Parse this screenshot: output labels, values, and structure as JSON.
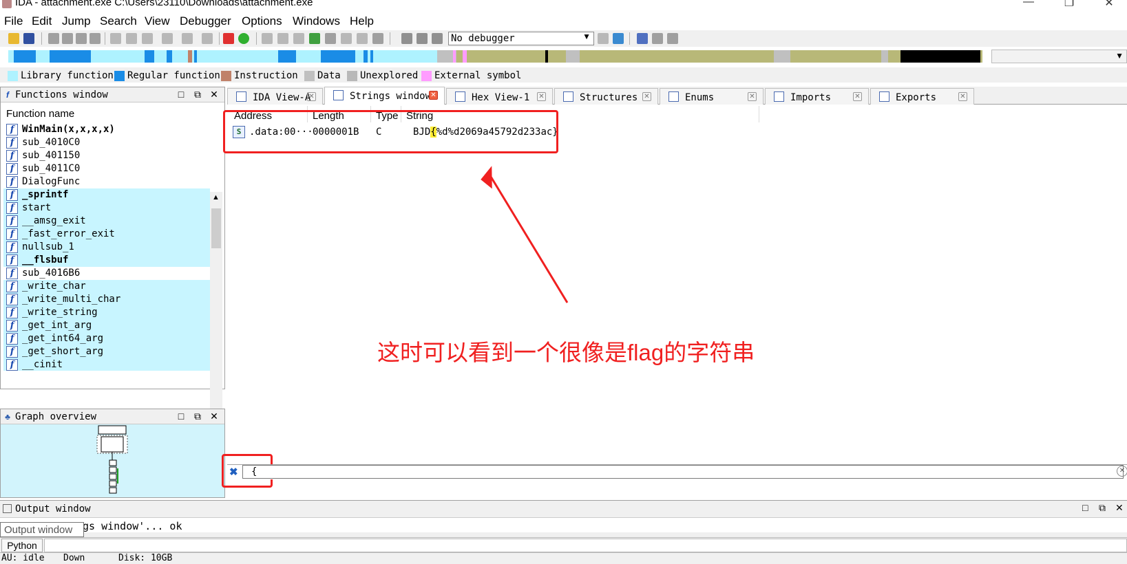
{
  "window": {
    "title": "IDA - attachment.exe C:\\Users\\23110\\Downloads\\attachment.exe"
  },
  "menu": [
    "File",
    "Edit",
    "Jump",
    "Search",
    "View",
    "Debugger",
    "Options",
    "Windows",
    "Help"
  ],
  "toolbar": {
    "debugger_select": "No debugger"
  },
  "legend": [
    {
      "label": "Library function",
      "color": "#aef2ff"
    },
    {
      "label": "Regular function",
      "color": "#1a8ce6"
    },
    {
      "label": "Instruction",
      "color": "#c0826a"
    },
    {
      "label": "Data",
      "color": "#c0c0c0"
    },
    {
      "label": "Unexplored",
      "color": "#b8b878"
    },
    {
      "label": "External symbol",
      "color": "#ff9cff"
    }
  ],
  "functions_window": {
    "title": "Functions window",
    "column": "Function name",
    "items": [
      {
        "name": "WinMain(x,x,x,x)",
        "lib": false,
        "bold": true
      },
      {
        "name": "sub_4010C0",
        "lib": false,
        "bold": false
      },
      {
        "name": "sub_401150",
        "lib": false,
        "bold": false
      },
      {
        "name": "sub_4011C0",
        "lib": false,
        "bold": false
      },
      {
        "name": "DialogFunc",
        "lib": false,
        "bold": false
      },
      {
        "name": "_sprintf",
        "lib": true,
        "bold": true
      },
      {
        "name": "start",
        "lib": true,
        "bold": false
      },
      {
        "name": "__amsg_exit",
        "lib": true,
        "bold": false
      },
      {
        "name": "_fast_error_exit",
        "lib": true,
        "bold": false
      },
      {
        "name": "nullsub_1",
        "lib": true,
        "bold": false
      },
      {
        "name": "__flsbuf",
        "lib": true,
        "bold": true
      },
      {
        "name": "sub_4016B6",
        "lib": false,
        "bold": false
      },
      {
        "name": "_write_char",
        "lib": true,
        "bold": false
      },
      {
        "name": "_write_multi_char",
        "lib": true,
        "bold": false
      },
      {
        "name": "_write_string",
        "lib": true,
        "bold": false
      },
      {
        "name": "_get_int_arg",
        "lib": true,
        "bold": false
      },
      {
        "name": "_get_int64_arg",
        "lib": true,
        "bold": false
      },
      {
        "name": "_get_short_arg",
        "lib": true,
        "bold": false
      },
      {
        "name": "__cinit",
        "lib": true,
        "bold": false
      }
    ]
  },
  "graph_overview": {
    "title": "Graph overview"
  },
  "tabs": [
    {
      "label": "IDA View-A",
      "icon": "ida-view-icon",
      "active": false
    },
    {
      "label": "Strings window",
      "icon": "strings-icon",
      "active": true
    },
    {
      "label": "Hex View-1",
      "icon": "hex-view-icon",
      "active": false
    },
    {
      "label": "Structures",
      "icon": "structures-icon",
      "active": false
    },
    {
      "label": "Enums",
      "icon": "enums-icon",
      "active": false
    },
    {
      "label": "Imports",
      "icon": "imports-icon",
      "active": false
    },
    {
      "label": "Exports",
      "icon": "exports-icon",
      "active": false
    }
  ],
  "strings_table": {
    "headers": [
      "Address",
      "Length",
      "Type",
      "String"
    ],
    "row": {
      "address": ".data:00···",
      "length": "0000001B",
      "type": "C",
      "string_prefix": "BJD",
      "string_highlight": "{",
      "string_rest": "%d%d2069a45792d233ac}"
    }
  },
  "annotation": "这时可以看到一个很像是flag的字符串",
  "filter": {
    "value": "{"
  },
  "output_window": {
    "title": "Output window",
    "text": "gs window'... ok",
    "tooltip": "Output window"
  },
  "python": {
    "label": "Python"
  },
  "status": {
    "au": "AU:  idle",
    "dir": "Down",
    "disk": "Disk: 10GB"
  }
}
